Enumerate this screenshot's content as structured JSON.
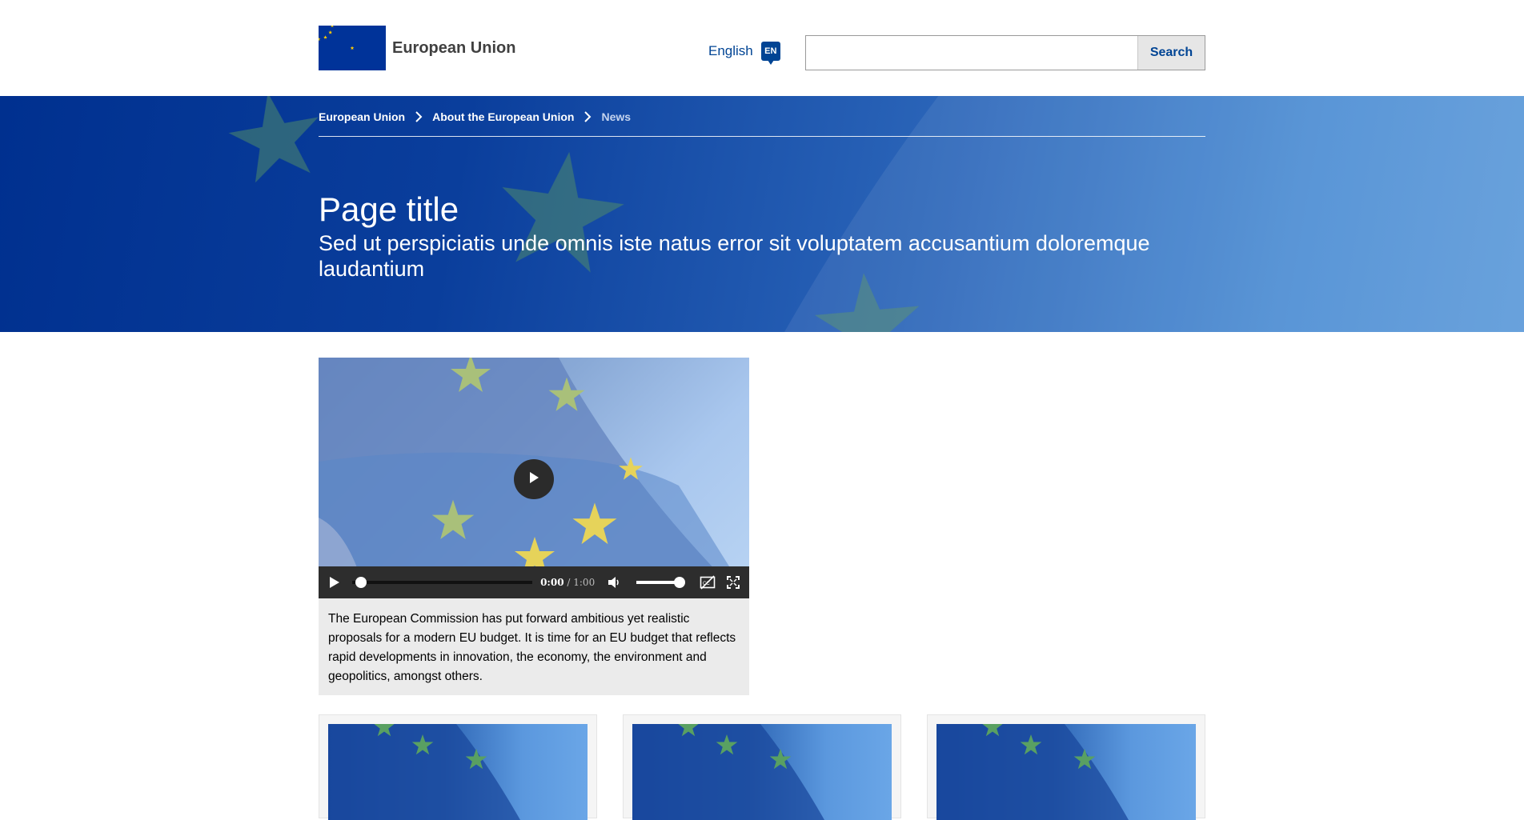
{
  "header": {
    "logo_text": "European Union",
    "language_label": "English",
    "language_code": "EN",
    "search_placeholder": "",
    "search_button": "Search"
  },
  "breadcrumb": {
    "items": [
      "European Union",
      "About the European Union"
    ],
    "current": "News"
  },
  "page": {
    "title": "Page title",
    "subtitle": "Sed ut perspiciatis unde omnis iste natus error sit voluptatem accusantium doloremque laudantium"
  },
  "video": {
    "current_time": "0:00",
    "separator": "/",
    "duration": "1:00",
    "progress": 0,
    "volume": 1,
    "caption": "The European Commission has put forward ambitious yet realistic proposals for a modern EU budget. It is time for an EU budget that reflects rapid developments in innovation, the economy, the environment and geopolitics, amongst others."
  },
  "cards": [
    {
      "image": "eu-flag-image"
    },
    {
      "image": "eu-flag-image"
    },
    {
      "image": "eu-flag-image"
    }
  ],
  "colors": {
    "eu_blue": "#003399",
    "link_blue": "#004494",
    "star_yellow": "#FFCC00"
  }
}
